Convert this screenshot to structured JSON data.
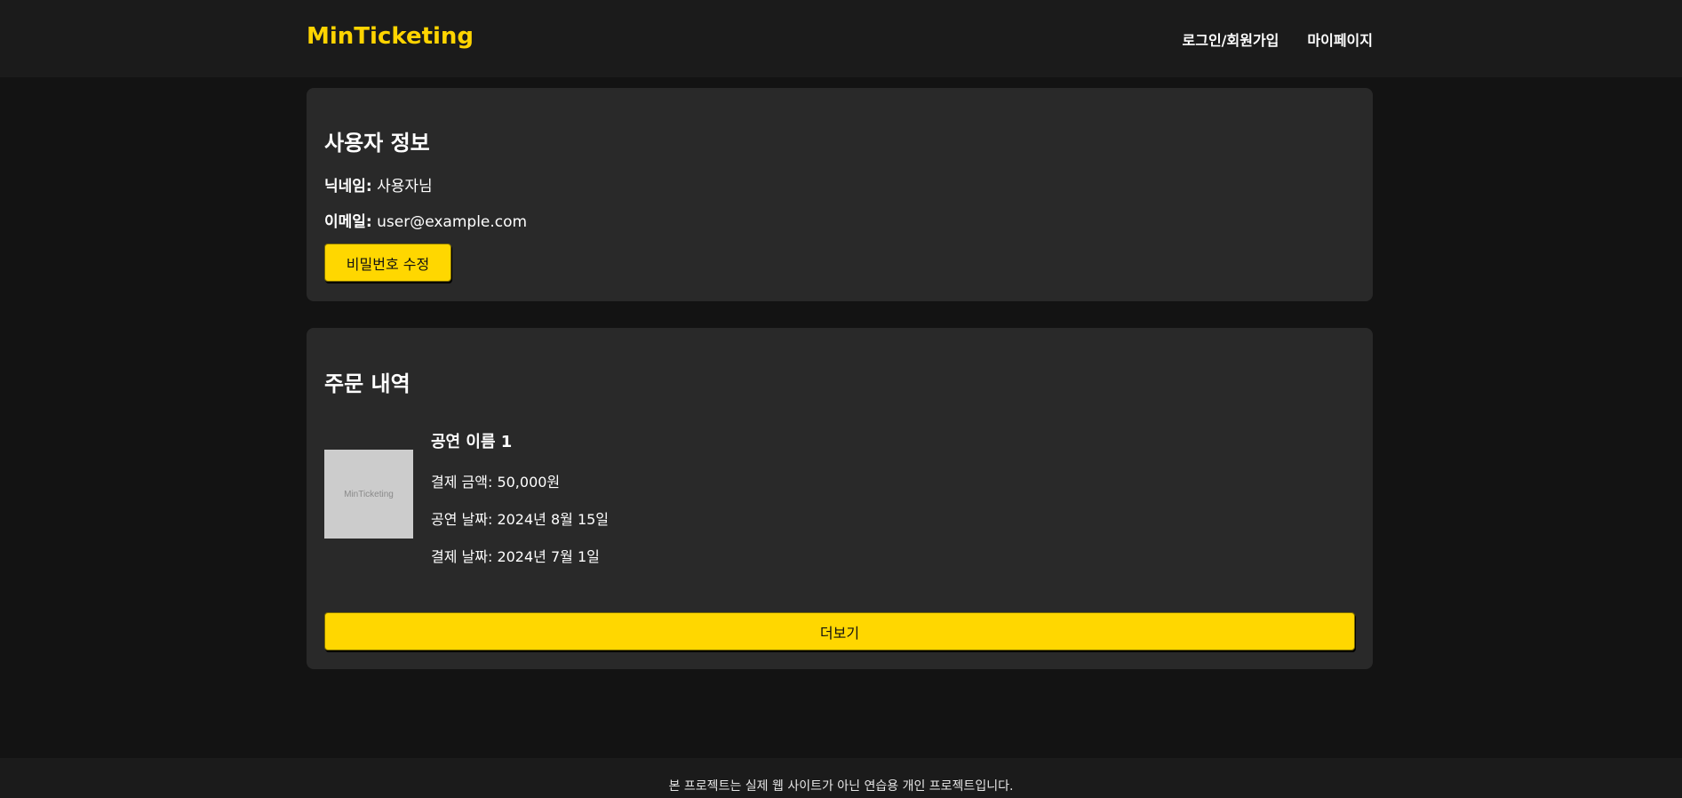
{
  "header": {
    "logo": "MinTicketing",
    "nav": [
      "로그인/회원가입",
      "마이페이지"
    ]
  },
  "user_info": {
    "title": "사용자 정보",
    "nickname_label": "닉네임:",
    "nickname": "사용자님",
    "email_label": "이메일:",
    "email": "user@example.com",
    "change_password_button": "비밀번호 수정"
  },
  "orders": {
    "title": "주문 내역",
    "items": [
      {
        "thumbnail_text": "MinTicketing",
        "name": "공연 이름 1",
        "price": "결제 금액: 50,000원",
        "show_date": "공연 날짜: 2024년 8월 15일",
        "pay_date": "결제 날짜: 2024년 7월 1일"
      }
    ],
    "more_button": "더보기"
  },
  "footer": {
    "text": "본 프로젝트는 실제 웹 사이트가 아닌 연습용 개인 프로젝트입니다."
  },
  "colors": {
    "accent": "#ffd700",
    "background": "#131313",
    "card": "#292929",
    "header": "#1b1b1b"
  }
}
